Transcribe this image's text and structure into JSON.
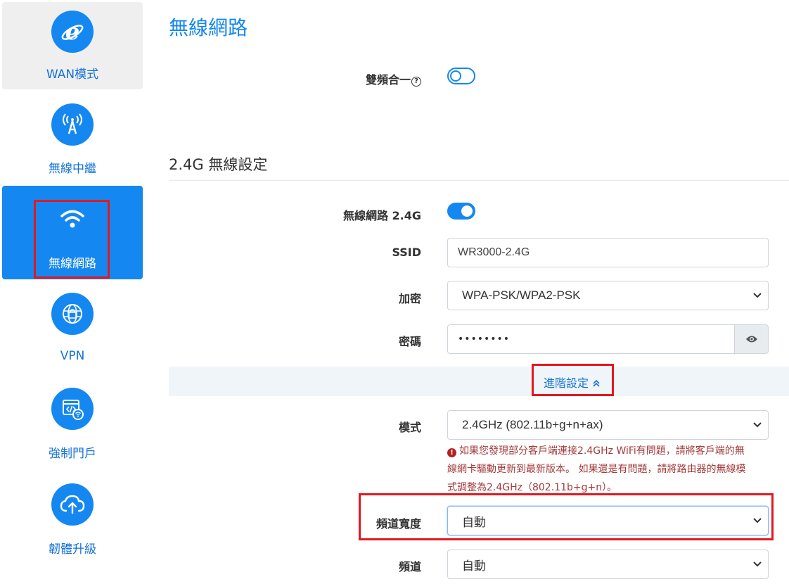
{
  "sidebar": {
    "items": [
      {
        "label": "WAN模式",
        "icon": "ie-icon"
      },
      {
        "label": "無線中繼",
        "icon": "repeater-antenna-icon"
      },
      {
        "label": "無線網路",
        "icon": "wifi-icon"
      },
      {
        "label": "VPN",
        "icon": "globe-lock-icon"
      },
      {
        "label": "強制門戶",
        "icon": "portal-code-icon"
      },
      {
        "label": "韌體升級",
        "icon": "cloud-upload-icon"
      }
    ]
  },
  "main": {
    "title": "無線網路",
    "dual_band": {
      "label": "雙頻合一",
      "help": "?",
      "enabled": false
    },
    "section_24g": {
      "title": "2.4G 無線設定",
      "wifi_toggle": {
        "label": "無線網路 2.4G",
        "enabled": true
      },
      "ssid": {
        "label": "SSID",
        "value": "WR3000-2.4G"
      },
      "encryption": {
        "label": "加密",
        "value": "WPA-PSK/WPA2-PSK"
      },
      "password": {
        "label": "密碼",
        "value": "••••••••",
        "toggle_icon": "eye-icon"
      },
      "advanced": {
        "label": "進階設定",
        "icon": "double-chevron-up-icon"
      },
      "mode": {
        "label": "模式",
        "value": "2.4GHz (802.11b+g+n+ax)",
        "warning_icon": "!",
        "warning_line1": "如果您發現部分客戶端連接2.4GHz WiFi有問題，請將客戶端的無",
        "warning_line2": "線網卡驅動更新到最新版本。 如果還是有問題，請將路由器的無線模",
        "warning_line3": "式調整為2.4GHz（802.11b+g+n）。"
      },
      "bandwidth": {
        "label": "頻道寬度",
        "value": "自動"
      },
      "channel": {
        "label": "頻道",
        "value": "自動"
      }
    }
  },
  "colors": {
    "accent": "#1587f0",
    "highlight_box": "#e0191f",
    "warning": "#a33a3a"
  }
}
